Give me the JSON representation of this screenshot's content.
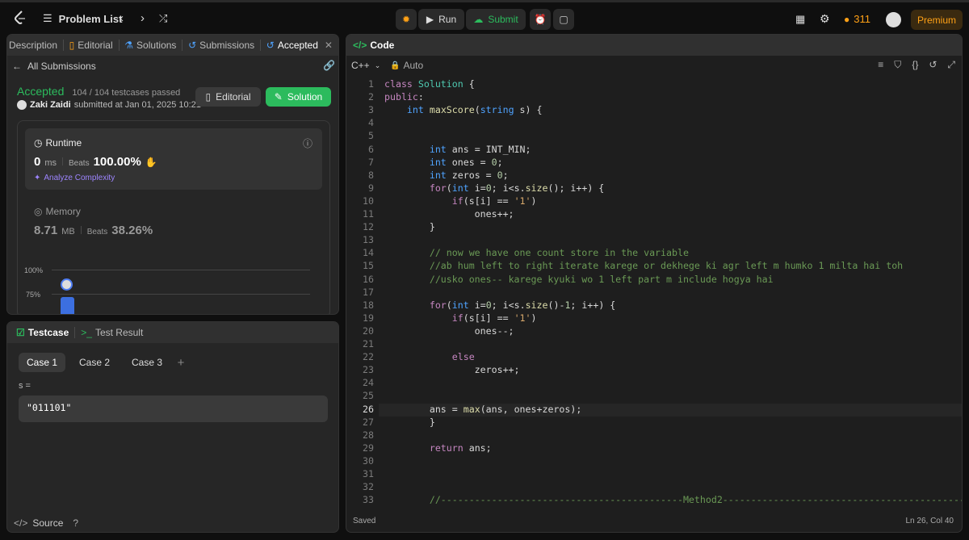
{
  "top": {
    "problem_list": "Problem List",
    "run": "Run",
    "submit": "Submit",
    "streak": "311",
    "premium": "Premium"
  },
  "left_tabs": [
    "Description",
    "Editorial",
    "Solutions",
    "Submissions",
    "Accepted"
  ],
  "submission": {
    "back": "All Submissions",
    "status": "Accepted",
    "testcases": "104 / 104 testcases passed",
    "user": "Zaki Zaidi",
    "submitted": "submitted at Jan 01, 2025 10:21",
    "editorial_btn": "Editorial",
    "solution_btn": "Solution"
  },
  "runtime": {
    "label": "Runtime",
    "value": "0",
    "unit": "ms",
    "beats_label": "Beats",
    "beats": "100.00%",
    "analyze": "Analyze Complexity"
  },
  "memory": {
    "label": "Memory",
    "value": "8.71",
    "unit": "MB",
    "beats_label": "Beats",
    "beats": "38.26%"
  },
  "chart": {
    "ticks": [
      "100%",
      "75%"
    ]
  },
  "testcase": {
    "tab": "Testcase",
    "result_tab": "Test Result",
    "cases": [
      "Case 1",
      "Case 2",
      "Case 3"
    ],
    "var_label": "s =",
    "value": "\"011101\"",
    "source": "Source"
  },
  "code": {
    "title": "Code",
    "lang": "C++",
    "mode": "Auto",
    "status": "Saved",
    "cursor": "Ln 26, Col 40",
    "current_line": 26
  },
  "colors": {
    "accent_green": "#2cbb5d",
    "accepted": "#2cbb5d",
    "orange": "#ffa116",
    "purple": "#9d85ff"
  }
}
